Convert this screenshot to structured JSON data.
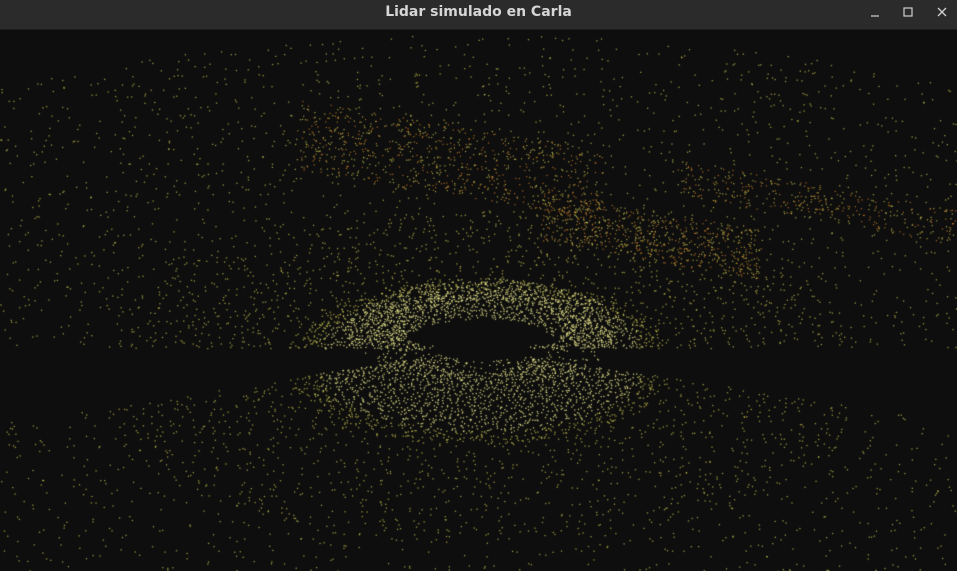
{
  "window": {
    "title": "Lidar simulado en Carla",
    "controls": [
      {
        "icon": "minimize-icon"
      },
      {
        "icon": "maximize-icon"
      },
      {
        "icon": "close-icon"
      }
    ]
  },
  "viewport": {
    "background": "#0e0e0e",
    "point_colors": {
      "near": "#e6e38a",
      "mid": "#d4cf55",
      "far": "#d98a2c"
    }
  }
}
